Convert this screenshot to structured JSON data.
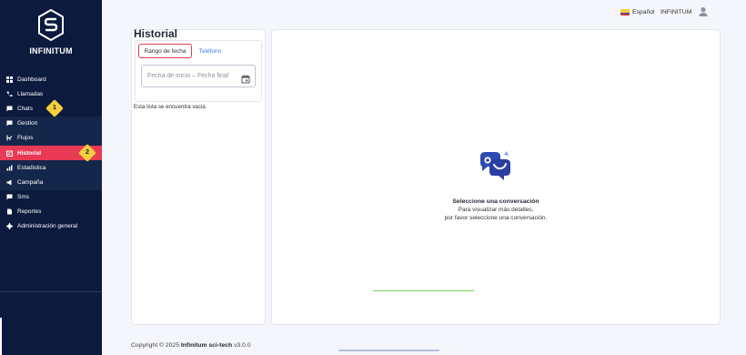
{
  "brand": {
    "name": "INFINITUM"
  },
  "sidebar": {
    "items": [
      {
        "label": "Dashboard",
        "icon": "grid-icon"
      },
      {
        "label": "Llamadas",
        "icon": "phone-icon"
      },
      {
        "label": "Chats",
        "icon": "chat-icon"
      },
      {
        "label": "Gestion",
        "icon": "chat-icon"
      },
      {
        "label": "Flujos",
        "icon": "flow-icon"
      },
      {
        "label": "Historial",
        "icon": "history-icon",
        "active": true
      },
      {
        "label": "Estadistica",
        "icon": "chart-icon"
      },
      {
        "label": "Campaña",
        "icon": "megaphone-icon"
      },
      {
        "label": "Sms",
        "icon": "sms-icon"
      },
      {
        "label": "Reportes",
        "icon": "report-icon"
      },
      {
        "label": "Administración general",
        "icon": "gear-icon"
      }
    ],
    "active_color": "#e83a55",
    "background_color": "#0b1a3d"
  },
  "annotations": {
    "badge1": "1",
    "badge2": "2"
  },
  "header": {
    "language": "Español",
    "user": "INFINITUM"
  },
  "page": {
    "title": "Historial"
  },
  "filters": {
    "tab_range": "Rango de fecha",
    "tab_phone": "Teléfono",
    "date_start_placeholder": "Fecha de inicio",
    "date_separator": "–",
    "date_end_placeholder": "Fecha final"
  },
  "list": {
    "empty_message": "Esta lista se encuentra vacia"
  },
  "conversation": {
    "title": "Seleccione una conversación",
    "line1": "Para visualizar más detalles,",
    "line2": "por favor seleccione una conversación."
  },
  "footer": {
    "prefix": "Copyright © 2025",
    "company": "Infinitum sci-tech",
    "version": "v3.0.0"
  }
}
